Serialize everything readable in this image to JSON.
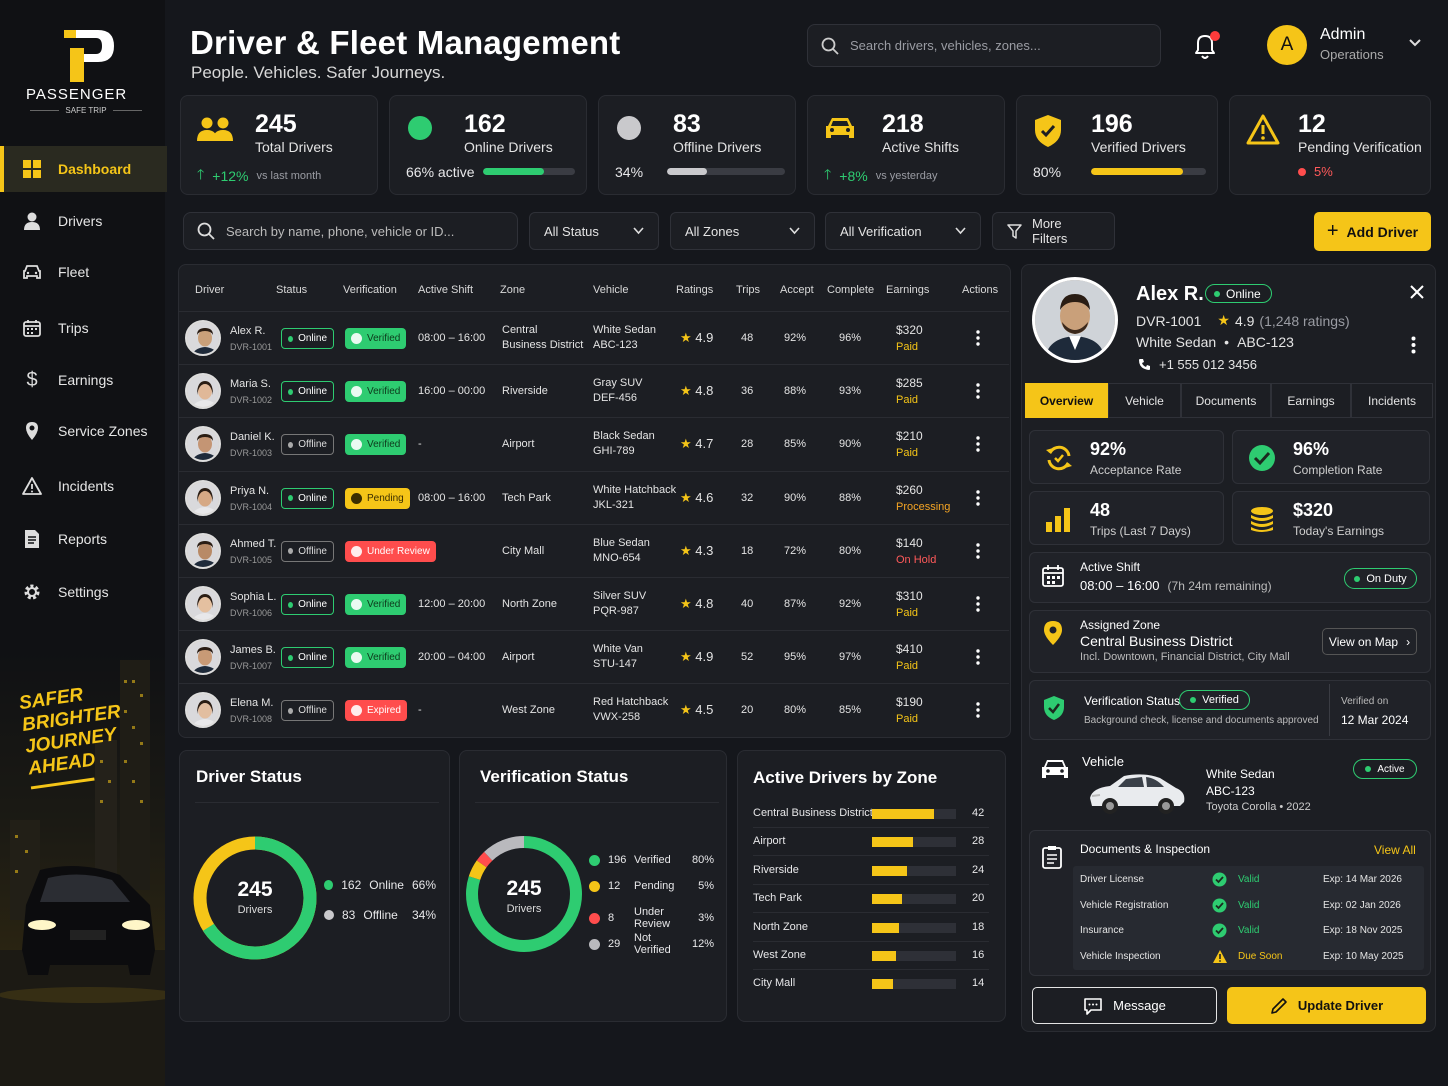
{
  "brand": {
    "name": "PASSENGER",
    "tagline": "SAFE TRIP",
    "promo": [
      "SAFER",
      "BRIGHTER",
      "JOURNEY",
      "AHEAD"
    ]
  },
  "nav": [
    {
      "label": "Dashboard",
      "icon": "dashboard-icon"
    },
    {
      "label": "Drivers",
      "icon": "user-icon"
    },
    {
      "label": "Fleet",
      "icon": "car-icon"
    },
    {
      "label": "Trips",
      "icon": "calendar-icon"
    },
    {
      "label": "Earnings",
      "icon": "dollar-icon"
    },
    {
      "label": "Service Zones",
      "icon": "map-pin-icon"
    },
    {
      "label": "Incidents",
      "icon": "warning-icon"
    },
    {
      "label": "Reports",
      "icon": "document-icon"
    },
    {
      "label": "Settings",
      "icon": "gear-icon"
    }
  ],
  "header": {
    "title": "Driver & Fleet Management",
    "subtitle": "People. Vehicles. Safer Journeys.",
    "search_placeholder": "Search drivers, vehicles, zones...",
    "user_initial": "A",
    "user_name": "Admin",
    "user_role": "Operations"
  },
  "stats": [
    {
      "num": "245",
      "label": "Total Drivers",
      "delta": "+12%",
      "note": "vs last month"
    },
    {
      "num": "162",
      "label": "Online Drivers",
      "foot": "66% active",
      "bar": 0.66
    },
    {
      "num": "83",
      "label": "Offline Drivers",
      "foot": "34%",
      "bar": 0.34
    },
    {
      "num": "218",
      "label": "Active Shifts",
      "delta": "+8%",
      "note": "vs yesterday"
    },
    {
      "num": "196",
      "label": "Verified Drivers",
      "foot": "80%",
      "bar": 0.8
    },
    {
      "num": "12",
      "label": "Pending Verification",
      "foot": "5%"
    }
  ],
  "filters": {
    "search_placeholder": "Search by name, phone, vehicle or ID...",
    "status": "All Status",
    "zones": "All Zones",
    "verification": "All Verification",
    "more": "More Filters",
    "add": "Add Driver"
  },
  "table": {
    "headers": [
      "Driver",
      "Status",
      "Verification",
      "Active Shift",
      "Zone",
      "Vehicle",
      "Ratings",
      "Trips",
      "Accept",
      "Complete",
      "Earnings",
      "Actions"
    ],
    "rows": [
      {
        "name": "Alex R.",
        "id": "DVR-1001",
        "status": "Online",
        "verification": "Verified",
        "shift": "08:00 – 16:00",
        "zone": [
          "Central",
          "Business District"
        ],
        "vehicle": [
          "White Sedan",
          "ABC-123"
        ],
        "rating": "4.9",
        "trips": "48",
        "accept": "92%",
        "complete": "96%",
        "earn": "$320",
        "pay": "Paid"
      },
      {
        "name": "Maria S.",
        "id": "DVR-1002",
        "status": "Online",
        "verification": "Verified",
        "shift": "16:00 – 00:00",
        "zone": [
          "Riverside"
        ],
        "vehicle": [
          "Gray SUV",
          "DEF-456"
        ],
        "rating": "4.8",
        "trips": "36",
        "accept": "88%",
        "complete": "93%",
        "earn": "$285",
        "pay": "Paid"
      },
      {
        "name": "Daniel K.",
        "id": "DVR-1003",
        "status": "Offline",
        "verification": "Verified",
        "shift": "-",
        "zone": [
          "Airport"
        ],
        "vehicle": [
          "Black Sedan",
          "GHI-789"
        ],
        "rating": "4.7",
        "trips": "28",
        "accept": "85%",
        "complete": "90%",
        "earn": "$210",
        "pay": "Paid"
      },
      {
        "name": "Priya N.",
        "id": "DVR-1004",
        "status": "Online",
        "verification": "Pending",
        "shift": "08:00 – 16:00",
        "zone": [
          "Tech Park"
        ],
        "vehicle": [
          "White Hatchback",
          "JKL-321"
        ],
        "rating": "4.6",
        "trips": "32",
        "accept": "90%",
        "complete": "88%",
        "earn": "$260",
        "pay": "Processing"
      },
      {
        "name": "Ahmed T.",
        "id": "DVR-1005",
        "status": "Offline",
        "verification": "Under Review",
        "shift": "-",
        "zone": [
          "City Mall"
        ],
        "vehicle": [
          "Blue Sedan",
          "MNO-654"
        ],
        "rating": "4.3",
        "trips": "18",
        "accept": "72%",
        "complete": "80%",
        "earn": "$140",
        "pay": "On Hold"
      },
      {
        "name": "Sophia L.",
        "id": "DVR-1006",
        "status": "Online",
        "verification": "Verified",
        "shift": "12:00 – 20:00",
        "zone": [
          "North Zone"
        ],
        "vehicle": [
          "Silver SUV",
          "PQR-987"
        ],
        "rating": "4.8",
        "trips": "40",
        "accept": "87%",
        "complete": "92%",
        "earn": "$310",
        "pay": "Paid"
      },
      {
        "name": "James B.",
        "id": "DVR-1007",
        "status": "Online",
        "verification": "Verified",
        "shift": "20:00 – 04:00",
        "zone": [
          "Airport"
        ],
        "vehicle": [
          "White Van",
          "STU-147"
        ],
        "rating": "4.9",
        "trips": "52",
        "accept": "95%",
        "complete": "97%",
        "earn": "$410",
        "pay": "Paid"
      },
      {
        "name": "Elena M.",
        "id": "DVR-1008",
        "status": "Offline",
        "verification": "Expired",
        "shift": "-",
        "zone": [
          "West Zone"
        ],
        "vehicle": [
          "Red Hatchback",
          "VWX-258"
        ],
        "rating": "4.5",
        "trips": "20",
        "accept": "80%",
        "complete": "85%",
        "earn": "$190",
        "pay": "Paid"
      }
    ]
  },
  "driver_status": {
    "title": "Driver Status",
    "center_num": "245",
    "center_lbl": "Drivers",
    "items": [
      {
        "count": "162",
        "label": "Online",
        "pct": "66%"
      },
      {
        "count": "83",
        "label": "Offline",
        "pct": "34%"
      }
    ]
  },
  "verification_status": {
    "title": "Verification Status",
    "center_num": "245",
    "center_lbl": "Drivers",
    "items": [
      {
        "count": "196",
        "label": "Verified",
        "pct": "80%"
      },
      {
        "count": "12",
        "label": "Pending",
        "pct": "5%"
      },
      {
        "count": "8",
        "label": "Under Review",
        "pct": "3%"
      },
      {
        "count": "29",
        "label": "Not Verified",
        "pct": "12%"
      }
    ]
  },
  "zones": {
    "title": "Active Drivers by Zone",
    "max": 42,
    "items": [
      {
        "zone": "Central Business District",
        "count": 42
      },
      {
        "zone": "Airport",
        "count": 28
      },
      {
        "zone": "Riverside",
        "count": 24
      },
      {
        "zone": "Tech Park",
        "count": 20
      },
      {
        "zone": "North Zone",
        "count": 18
      },
      {
        "zone": "West Zone",
        "count": 16
      },
      {
        "zone": "City Mall",
        "count": 14
      }
    ]
  },
  "detail": {
    "name": "Alex R.",
    "status": "Online",
    "id": "DVR-1001",
    "rating": "4.9",
    "rating_count": "(1,248 ratings)",
    "vehicle": "White Sedan",
    "plate": "ABC-123",
    "phone": "+1 555 012 3456",
    "tabs": [
      "Overview",
      "Vehicle",
      "Documents",
      "Earnings",
      "Incidents"
    ],
    "metrics": [
      {
        "v": "92%",
        "l": "Acceptance Rate"
      },
      {
        "v": "96%",
        "l": "Completion Rate"
      },
      {
        "v": "48",
        "l": "Trips (Last 7 Days)"
      },
      {
        "v": "$320",
        "l": "Today's Earnings"
      }
    ],
    "shift_label": "Active Shift",
    "shift_time": "08:00 – 16:00",
    "shift_remaining": "(7h 24m remaining)",
    "shift_badge": "On Duty",
    "zone_label": "Assigned Zone",
    "zone_name": "Central Business District",
    "zone_sub": "Incl. Downtown, Financial District, City Mall",
    "zone_btn": "View on Map",
    "ver_label": "Verification Status",
    "ver_badge": "Verified",
    "ver_sub": "Background check, license and documents approved",
    "ver_on": "Verified on",
    "ver_date": "12 Mar 2024",
    "veh_label": "Vehicle",
    "veh_badge": "Active",
    "veh_name": "White Sedan",
    "veh_plate": "ABC-123",
    "veh_model": "Toyota Corolla • 2022",
    "docs_label": "Documents & Inspection",
    "docs_link": "View All",
    "docs": [
      {
        "name": "Driver License",
        "state": "Valid",
        "exp": "Exp: 14 Mar 2026"
      },
      {
        "name": "Vehicle Registration",
        "state": "Valid",
        "exp": "Exp: 02 Jan 2026"
      },
      {
        "name": "Insurance",
        "state": "Valid",
        "exp": "Exp: 18 Nov 2025"
      },
      {
        "name": "Vehicle Inspection",
        "state": "Due Soon",
        "exp": "Exp: 10 May 2025"
      }
    ],
    "msg_btn": "Message",
    "update_btn": "Update Driver"
  },
  "colors": {
    "accent": "#f5c518",
    "online": "#2ecc71",
    "danger": "#ff4d4d",
    "bg": "#15171c"
  }
}
